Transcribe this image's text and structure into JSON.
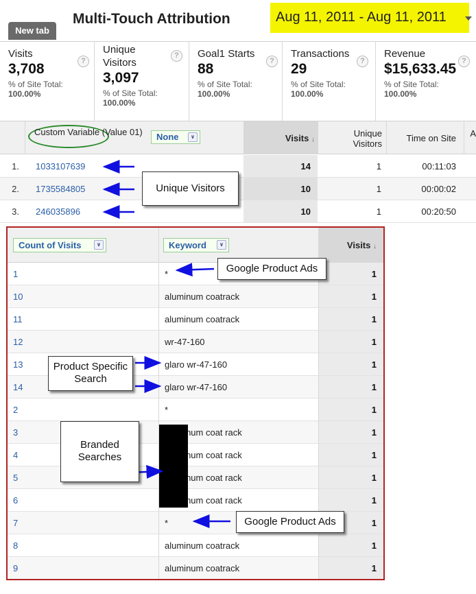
{
  "header": {
    "title": "Multi-Touch Attribution",
    "new_tab": "New tab",
    "date_range": "Aug 11, 2011 - Aug 11, 2011"
  },
  "metrics": [
    {
      "label": "Visits",
      "value": "3,708",
      "site_total_label": "% of Site Total:",
      "site_total": "100.00%"
    },
    {
      "label": "Unique Visitors",
      "value": "3,097",
      "site_total_label": "% of Site Total:",
      "site_total": "100.00%"
    },
    {
      "label": "Goal1 Starts",
      "value": "88",
      "site_total_label": "% of Site Total:",
      "site_total": "100.00%"
    },
    {
      "label": "Transactions",
      "value": "29",
      "site_total_label": "% of Site Total:",
      "site_total": "100.00%"
    },
    {
      "label": "Revenue",
      "value": "$15,633.45",
      "site_total_label": "% of Site Total:",
      "site_total": "100.00%"
    }
  ],
  "table1": {
    "headers": {
      "dimension": "Custom Variable (Value 01)",
      "secondary": "None",
      "visits": "Visits",
      "unique_visitors": "Unique Visitors",
      "time_on_site": "Time on Site",
      "extra": "A"
    },
    "rows": [
      {
        "index": "1.",
        "value": "1033107639",
        "visits": "14",
        "unique": "1",
        "time": "00:11:03"
      },
      {
        "index": "2.",
        "value": "1735584805",
        "visits": "10",
        "unique": "1",
        "time": "00:00:02"
      },
      {
        "index": "3.",
        "value": "246035896",
        "visits": "10",
        "unique": "1",
        "time": "00:20:50"
      }
    ]
  },
  "table2": {
    "headers": {
      "count": "Count of Visits",
      "keyword": "Keyword",
      "visits": "Visits"
    },
    "rows": [
      {
        "count": "1",
        "keyword": "*",
        "visits": "1"
      },
      {
        "count": "10",
        "keyword": "aluminum coatrack",
        "visits": "1"
      },
      {
        "count": "11",
        "keyword": "aluminum coatrack",
        "visits": "1"
      },
      {
        "count": "12",
        "keyword": "wr-47-160",
        "visits": "1"
      },
      {
        "count": "13",
        "keyword": "glaro wr-47-160",
        "visits": "1"
      },
      {
        "count": "14",
        "keyword": "glaro wr-47-160",
        "visits": "1"
      },
      {
        "count": "2",
        "keyword": "*",
        "visits": "1"
      },
      {
        "count": "3",
        "keyword": "aluminum coat rack",
        "visits": "1"
      },
      {
        "count": "4",
        "keyword": "aluminum coat rack",
        "visits": "1"
      },
      {
        "count": "5",
        "keyword": "aluminum coat rack",
        "visits": "1"
      },
      {
        "count": "6",
        "keyword": "aluminum coat rack",
        "visits": "1"
      },
      {
        "count": "7",
        "keyword": "*",
        "visits": "1"
      },
      {
        "count": "8",
        "keyword": "aluminum coatrack",
        "visits": "1"
      },
      {
        "count": "9",
        "keyword": "aluminum coatrack",
        "visits": "1"
      }
    ]
  },
  "annotations": {
    "unique_visitors": "Unique Visitors",
    "google_product_ads_1": "Google Product Ads",
    "product_specific_search": "Product Specific Search",
    "branded_searches": "Branded Searches",
    "google_product_ads_2": "Google Product Ads"
  },
  "colors": {
    "link": "#2a5ea8",
    "date_highlight": "#f4f400",
    "annotation_arrow": "#1010e0",
    "highlight_ellipse": "#2a8a2a",
    "outline_box": "#b22222"
  }
}
